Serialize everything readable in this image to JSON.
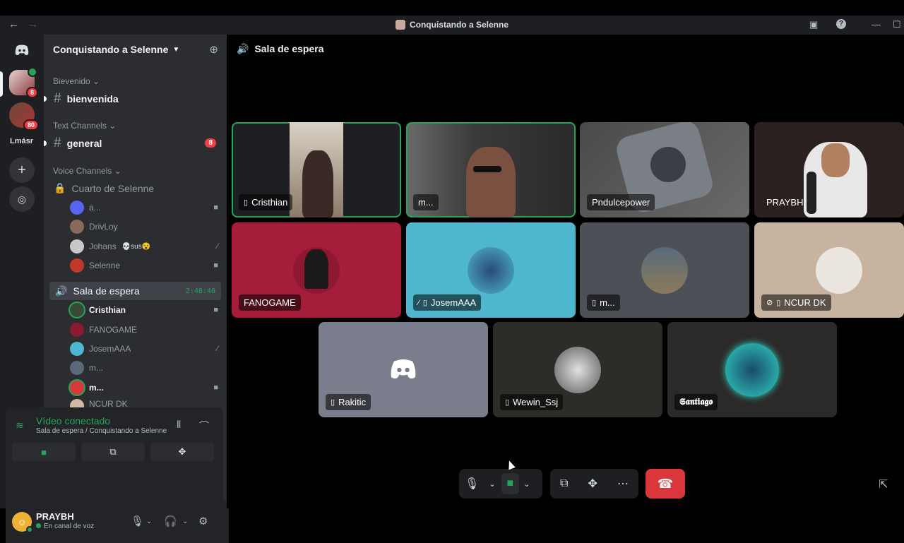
{
  "window": {
    "title": "Conquistando a Selenne",
    "back_icon": "←",
    "forward_icon": "→"
  },
  "guilds": {
    "more_label": "Lmásr",
    "badge_server1": "8",
    "badge_server2": "80"
  },
  "server": {
    "name": "Conquistando a Selenne"
  },
  "categories": {
    "welcome": "Bievenido",
    "text": "Text Channels",
    "voice": "Voice Channels"
  },
  "channels": {
    "bienvenida": "bienvenida",
    "general": "general",
    "general_badge": "8",
    "cuarto": "Cuarto de Selenne",
    "sala": "Sala de espera",
    "sala_timer": "2:48:40"
  },
  "cuarto_users": [
    {
      "name": "a..."
    },
    {
      "name": "DrivLoy"
    },
    {
      "name": "Johans",
      "tag": "💀sus😵"
    },
    {
      "name": "Selenne"
    }
  ],
  "sala_users": [
    {
      "name": "Cristhian"
    },
    {
      "name": "FANOGAME"
    },
    {
      "name": "JosemAAA"
    },
    {
      "name": "m..."
    },
    {
      "name": "m..."
    },
    {
      "name": "NCUR DK"
    }
  ],
  "voice_panel": {
    "status": "Vídeo conectado",
    "location": "Sala de espera / Conquistando a Selenne"
  },
  "user": {
    "name": "PRAYBH",
    "status": "En canal de voz"
  },
  "stage": {
    "title": "Sala de espera"
  },
  "tiles": [
    {
      "name": "Cristhian"
    },
    {
      "name": "m..."
    },
    {
      "name": "Pndulcepower"
    },
    {
      "name": "PRAYBH"
    },
    {
      "name": "FANOGAME"
    },
    {
      "name": "JosemAAA"
    },
    {
      "name": "m..."
    },
    {
      "name": "NCUR DK"
    },
    {
      "name": "Rakitic"
    },
    {
      "name": "Wewin_Ssj"
    },
    {
      "name": "𝕾𝖆𝖓𝖙𝖎𝖆𝖌𝖔"
    }
  ],
  "colors": {
    "accent_green": "#23a55a",
    "danger": "#da373c",
    "tile_red": "#a51d3a",
    "tile_cyan": "#4fb6cf",
    "blurple": "#5865f2"
  }
}
